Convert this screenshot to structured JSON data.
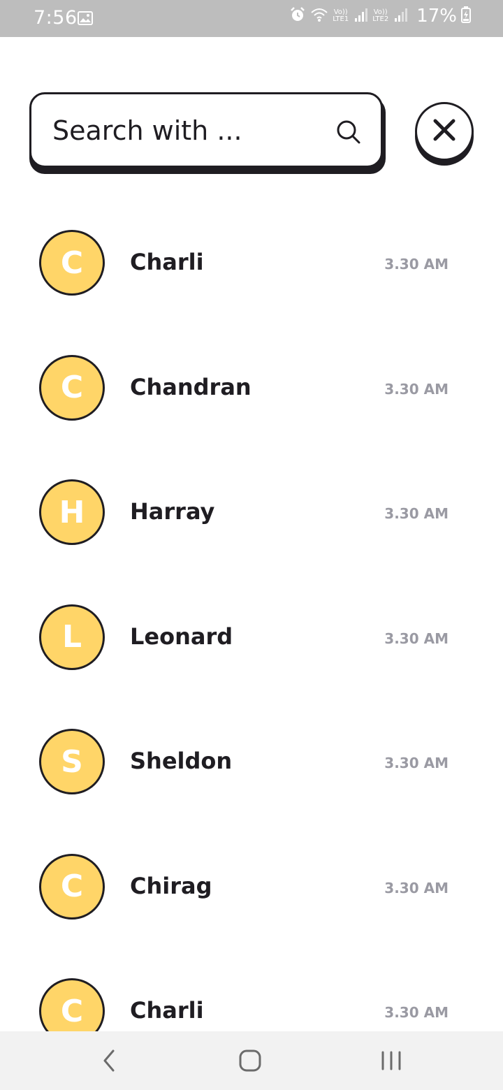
{
  "status_bar": {
    "time": "7:56",
    "lte1": {
      "volte": "Vo))",
      "label": "LTE1"
    },
    "lte2": {
      "volte": "Vo))",
      "label": "LTE2"
    },
    "battery": "17%"
  },
  "search": {
    "placeholder": "Search with ...",
    "value": ""
  },
  "contacts": [
    {
      "initial": "C",
      "name": "Charli",
      "time": "3.30 AM"
    },
    {
      "initial": "C",
      "name": "Chandran",
      "time": "3.30 AM"
    },
    {
      "initial": "H",
      "name": "Harray",
      "time": "3.30 AM"
    },
    {
      "initial": "L",
      "name": "Leonard",
      "time": "3.30 AM"
    },
    {
      "initial": "S",
      "name": "Sheldon",
      "time": "3.30 AM"
    },
    {
      "initial": "C",
      "name": "Chirag",
      "time": "3.30 AM"
    },
    {
      "initial": "C",
      "name": "Charli",
      "time": "3.30 AM"
    }
  ],
  "colors": {
    "avatar_fill": "#ffd568",
    "ink": "#1f1d22",
    "time_text": "#9a9aa3",
    "status_bar": "#bdbdbd",
    "nav_bar": "#f2f2f2"
  },
  "icons": {
    "search": "search-icon",
    "close": "close-icon",
    "nav_back": "back-icon",
    "nav_home": "home-icon",
    "nav_recents": "recents-icon"
  }
}
